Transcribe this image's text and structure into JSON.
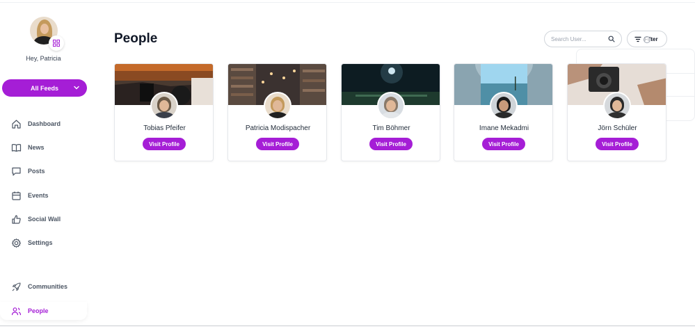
{
  "user": {
    "greeting": "Hey, Patricia"
  },
  "sidebar": {
    "feeds_label": "All Feeds",
    "items": [
      {
        "label": "Dashboard",
        "icon": "home-icon",
        "active": false
      },
      {
        "label": "News",
        "icon": "book-icon",
        "active": false
      },
      {
        "label": "Posts",
        "icon": "chat-bubble-icon",
        "active": false
      },
      {
        "label": "Events",
        "icon": "calendar-icon",
        "active": false
      },
      {
        "label": "Social Wall",
        "icon": "thumbs-up-icon",
        "active": false
      },
      {
        "label": "Settings",
        "icon": "gear-icon",
        "active": false
      },
      {
        "label": "Communities",
        "icon": "rocket-icon",
        "active": false
      },
      {
        "label": "People",
        "icon": "users-icon",
        "active": true
      }
    ]
  },
  "main": {
    "title": "People",
    "search": {
      "placeholder": "Search User...",
      "value": ""
    },
    "filter_label": "Filter",
    "people": [
      {
        "name": "Tobias Pfeifer",
        "button": "Visit Profile"
      },
      {
        "name": "Patricia Modispacher",
        "button": "Visit Profile"
      },
      {
        "name": "Tim Böhmer",
        "button": "Visit Profile"
      },
      {
        "name": "Imane Mekadmi",
        "button": "Visit Profile"
      },
      {
        "name": "Jörn Schüler",
        "button": "Visit Profile"
      }
    ]
  },
  "colors": {
    "accent": "#a51ed6",
    "text": "#1f2937",
    "muted": "#4b5563"
  }
}
